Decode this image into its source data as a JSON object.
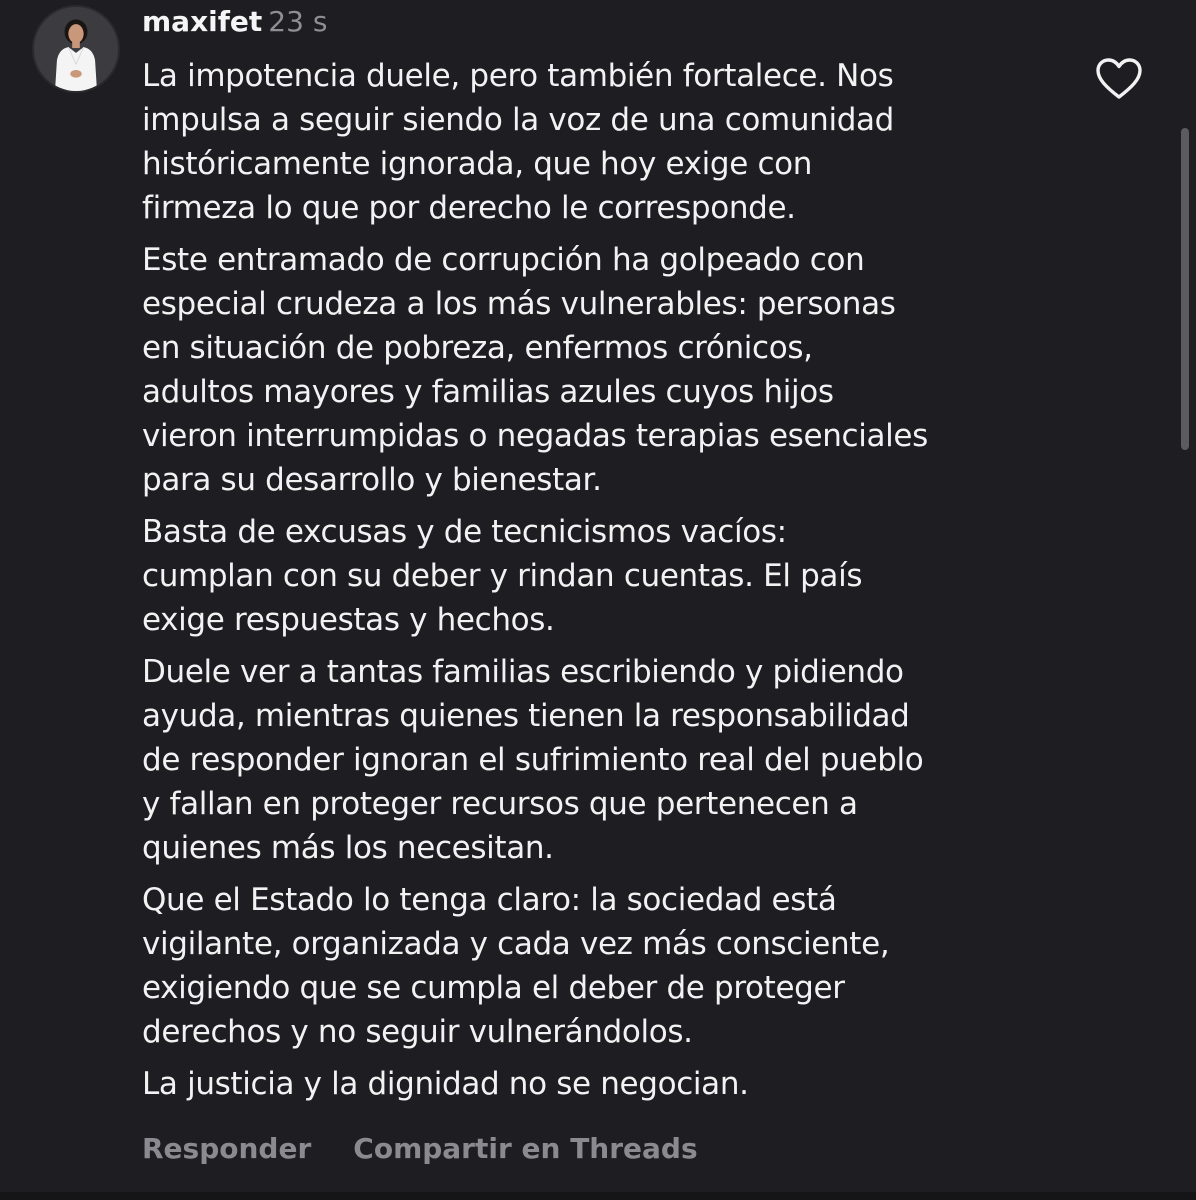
{
  "comment": {
    "username": "maxifet",
    "timestamp": "23 s",
    "avatar_icon": "profile-photo-avatar",
    "like_icon": "heart-outline-icon",
    "paragraphs": [
      {
        "lines": [
          "La impotencia duele, pero también fortalece. Nos",
          "impulsa a seguir siendo la voz de una comunidad",
          "históricamente ignorada, que hoy exige con",
          "firmeza lo que por derecho le corresponde."
        ]
      },
      {
        "lines": [
          "Este entramado de corrupción ha golpeado con",
          "especial crudeza a los más vulnerables: personas",
          "en situación de pobreza, enfermos crónicos,",
          "adultos mayores y familias azules cuyos hijos",
          "vieron interrumpidas o negadas terapias esenciales",
          "para su desarrollo y bienestar."
        ]
      },
      {
        "lines": [
          "Basta de excusas y de tecnicismos vacíos:",
          "cumplan con su deber y rindan cuentas. El país",
          "exige respuestas y hechos."
        ]
      },
      {
        "lines": [
          "Duele ver a tantas familias escribiendo y pidiendo",
          "ayuda, mientras quienes tienen la responsabilidad",
          "de responder ignoran el sufrimiento real del pueblo",
          "y fallan en proteger recursos que pertenecen a",
          "quienes más los necesitan."
        ]
      },
      {
        "lines": [
          "Que el Estado lo tenga claro: la sociedad está",
          "vigilante, organizada y cada vez más consciente,",
          "exigiendo que se cumpla el deber de proteger",
          "derechos y no seguir vulnerándolos."
        ]
      },
      {
        "lines": [
          "La justicia y la dignidad no se negocian."
        ]
      }
    ],
    "actions": {
      "reply_label": "Responder",
      "share_label": "Compartir en Threads"
    }
  },
  "colors": {
    "background": "#1e1e22",
    "text": "#f2f2f3",
    "muted": "#8e8e93"
  }
}
